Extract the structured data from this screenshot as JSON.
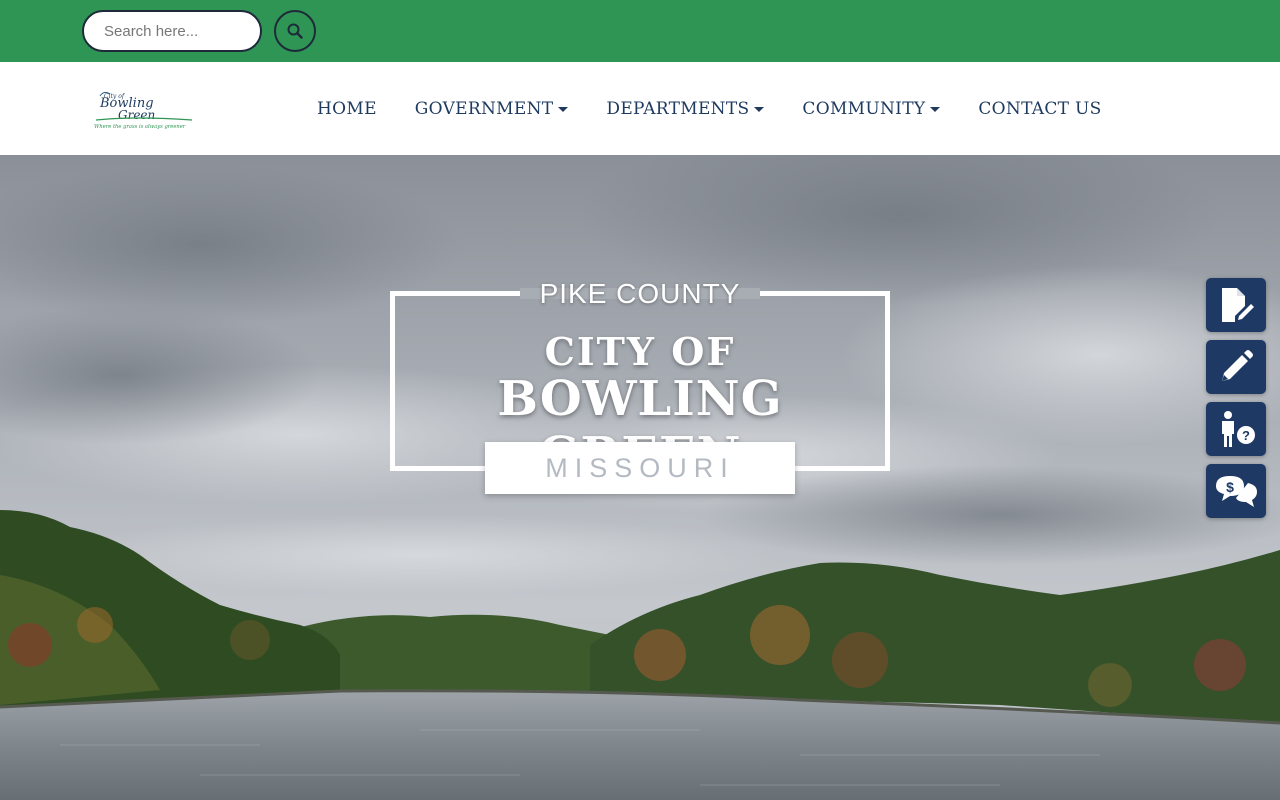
{
  "search": {
    "placeholder": "Search here..."
  },
  "logo": {
    "line1": "City of",
    "line2": "Bowling",
    "line3": "Green",
    "tagline": "Where the grass is always greener"
  },
  "nav": {
    "items": [
      {
        "label": "HOME",
        "dropdown": false
      },
      {
        "label": "GOVERNMENT",
        "dropdown": true
      },
      {
        "label": "DEPARTMENTS",
        "dropdown": true
      },
      {
        "label": "COMMUNITY",
        "dropdown": true
      },
      {
        "label": "CONTACT US",
        "dropdown": false
      }
    ]
  },
  "hero": {
    "county": "PIKE COUNTY",
    "city_prefix": "CITY OF",
    "city_name": "BOWLING GREEN",
    "state": "MISSOURI"
  },
  "quick_links": [
    {
      "icon": "document-edit-icon"
    },
    {
      "icon": "pen-icon"
    },
    {
      "icon": "person-question-icon"
    },
    {
      "icon": "dollar-chat-icon"
    }
  ],
  "colors": {
    "top_bar": "#2e9554",
    "nav_text": "#1e3a5f",
    "quick_link_bg": "#1e3a64"
  }
}
